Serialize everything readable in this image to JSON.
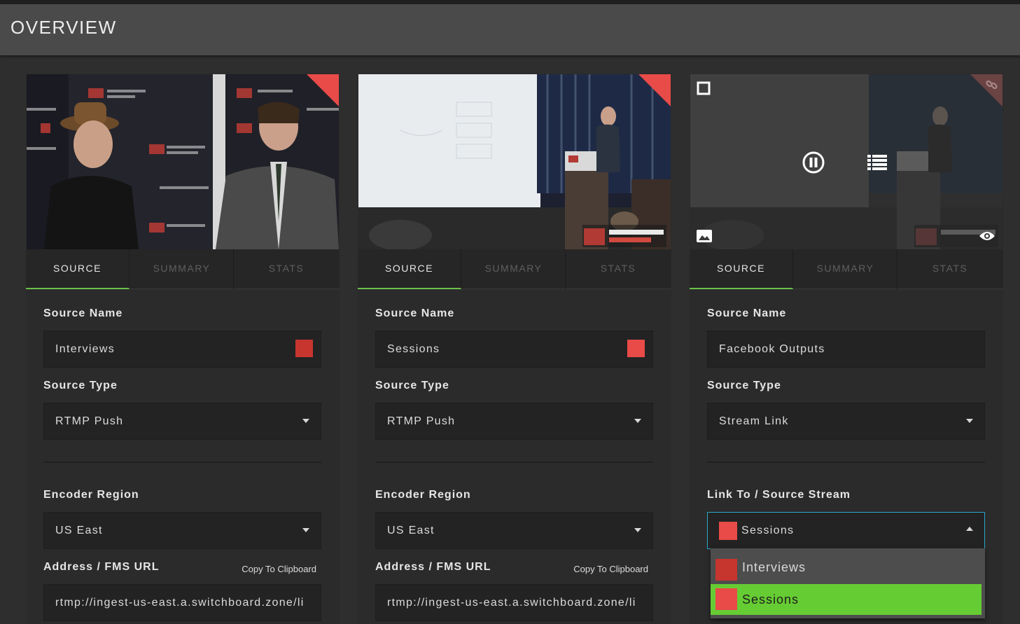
{
  "header": {
    "title": "OVERVIEW"
  },
  "tabs": [
    "SOURCE",
    "SUMMARY",
    "STATS"
  ],
  "labels": {
    "source_name": "Source Name",
    "source_type": "Source Type",
    "encoder_region": "Encoder Region",
    "address": "Address / FMS URL",
    "copy": "Copy To Clipboard",
    "link_to": "Link To / Source Stream"
  },
  "cards": [
    {
      "source_name": "Interviews",
      "color": "#c7352f",
      "source_type": "RTMP Push",
      "encoder_region": "US East",
      "address": "rtmp://ingest-us-east.a.switchboard.zone/li"
    },
    {
      "source_name": "Sessions",
      "color": "#e84b48",
      "source_type": "RTMP Push",
      "encoder_region": "US East",
      "address": "rtmp://ingest-us-east.a.switchboard.zone/li"
    },
    {
      "source_name": "Facebook Outputs",
      "source_type": "Stream Link",
      "link_to_selected": "Sessions",
      "link_options": [
        "Interviews",
        "Sessions"
      ]
    }
  ],
  "colors": {
    "accent_green": "#66cc33",
    "tab_underline": "#6cc04a",
    "corner_red": "#e84b48",
    "focus_blue": "#2aa6c8"
  },
  "icons": [
    "pause-icon",
    "list-icon",
    "checkbox-icon",
    "image-icon",
    "eye-icon",
    "link-icon",
    "chevron-down-icon",
    "chevron-up-icon"
  ]
}
